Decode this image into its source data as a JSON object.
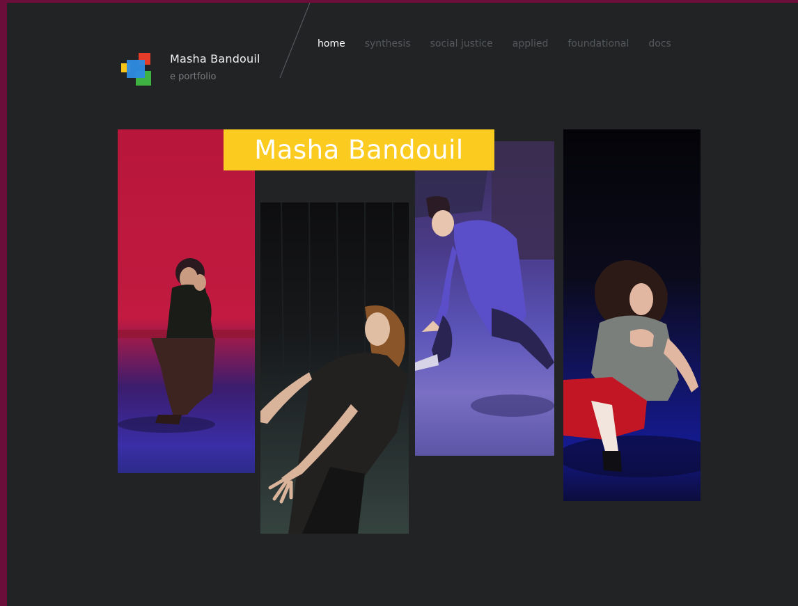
{
  "header": {
    "site_title": "Masha Bandouil",
    "site_subtitle": "e portfolio"
  },
  "nav": {
    "items": [
      {
        "label": "home",
        "active": true
      },
      {
        "label": "synthesis",
        "active": false
      },
      {
        "label": "social justice",
        "active": false
      },
      {
        "label": "applied",
        "active": false
      },
      {
        "label": "foundational",
        "active": false
      },
      {
        "label": "docs",
        "active": false
      }
    ]
  },
  "hero": {
    "banner_text": "Masha Bandouil"
  },
  "colors": {
    "background": "#212325",
    "frame": "#6b0f3a",
    "banner": "#fbcb1f",
    "nav_active": "#ffffff",
    "nav_inactive": "#55585c"
  }
}
